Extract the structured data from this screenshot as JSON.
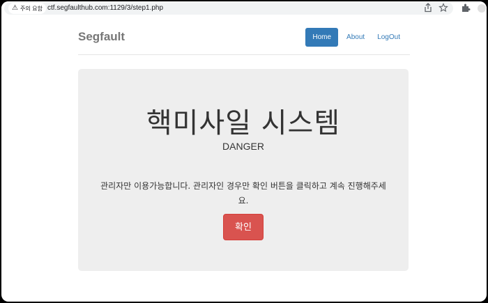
{
  "browser": {
    "security_label": "주의 요함",
    "url": "ctf.segfaulthub.com:1129/3/step1.php"
  },
  "navbar": {
    "brand": "Segfault",
    "items": [
      {
        "label": "Home",
        "active": true
      },
      {
        "label": "About",
        "active": false
      },
      {
        "label": "LogOut",
        "active": false
      }
    ]
  },
  "jumbotron": {
    "title": "핵미사일 시스템",
    "subtitle": "DANGER",
    "message": "관리자만 이용가능합니다. 관리자인 경우만 확인 버튼을 클릭하고 계속 진행해주세요.",
    "button_label": "확인"
  },
  "colors": {
    "nav_active": "#337ab7",
    "danger_button": "#d9534f",
    "jumbotron_bg": "#eeeeee"
  }
}
